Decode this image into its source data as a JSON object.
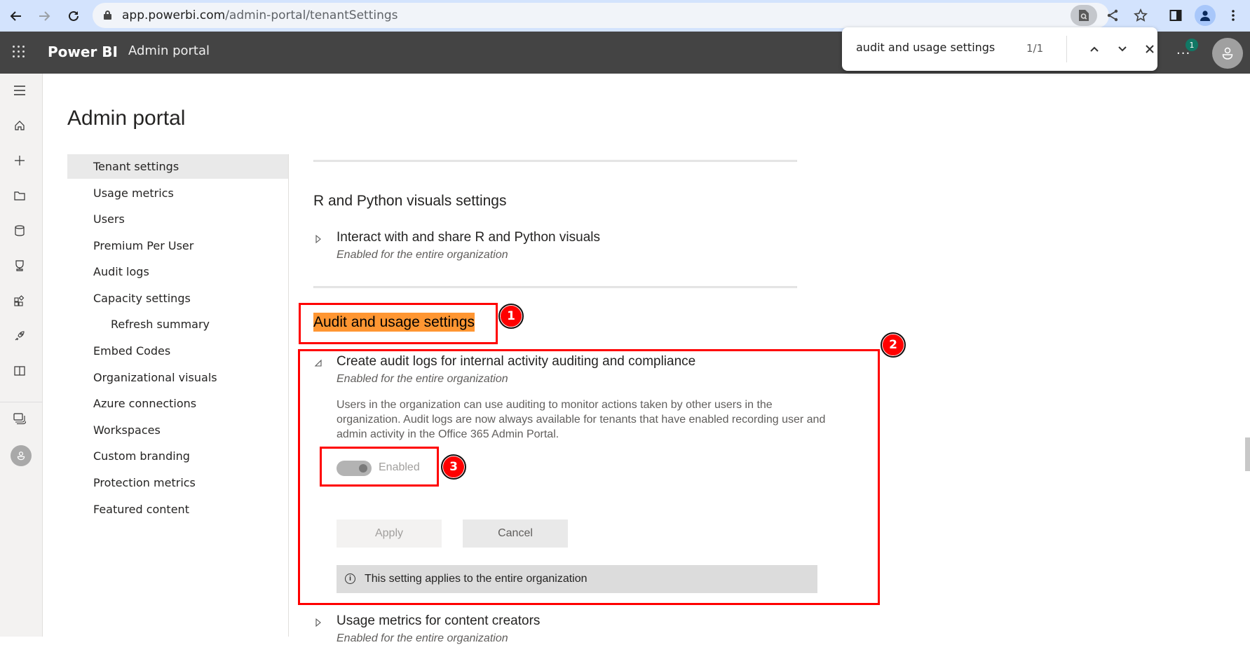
{
  "browser": {
    "url_host": "app.powerbi.com",
    "url_path": "/admin-portal/tenantSettings",
    "icons": [
      "back-icon",
      "forward-icon",
      "reload-icon",
      "lock-icon",
      "search-page-icon",
      "share-icon",
      "bookmark-star-icon",
      "side-panel-icon",
      "profile-icon",
      "menu-kebab-icon"
    ]
  },
  "find_bar": {
    "query": "audit and usage settings",
    "count": "1/1"
  },
  "appbar": {
    "brand": "Power BI",
    "section": "Admin portal",
    "more": "...",
    "notification_count": "1"
  },
  "rail": {
    "icons": [
      "hamburger-menu-icon",
      "home-icon",
      "create-plus-icon",
      "browse-folder-icon",
      "data-hub-cylinder-icon",
      "metrics-trophy-icon",
      "apps-icon",
      "deployment-pipelines-rocket-icon",
      "learn-book-icon",
      "workspaces-icon",
      "account-avatar-icon"
    ]
  },
  "page": {
    "title": "Admin portal"
  },
  "admin_nav": [
    {
      "label": "Tenant settings",
      "active": true,
      "sub": false
    },
    {
      "label": "Usage metrics",
      "active": false,
      "sub": false
    },
    {
      "label": "Users",
      "active": false,
      "sub": false
    },
    {
      "label": "Premium Per User",
      "active": false,
      "sub": false
    },
    {
      "label": "Audit logs",
      "active": false,
      "sub": false
    },
    {
      "label": "Capacity settings",
      "active": false,
      "sub": false
    },
    {
      "label": "Refresh summary",
      "active": false,
      "sub": true
    },
    {
      "label": "Embed Codes",
      "active": false,
      "sub": false
    },
    {
      "label": "Organizational visuals",
      "active": false,
      "sub": false
    },
    {
      "label": "Azure connections",
      "active": false,
      "sub": false
    },
    {
      "label": "Workspaces",
      "active": false,
      "sub": false
    },
    {
      "label": "Custom branding",
      "active": false,
      "sub": false
    },
    {
      "label": "Protection metrics",
      "active": false,
      "sub": false
    },
    {
      "label": "Featured content",
      "active": false,
      "sub": false
    }
  ],
  "content": {
    "r_python": {
      "section_title": "R and Python visuals settings",
      "setting_title": "Interact with and share R and Python visuals",
      "setting_status": "Enabled for the entire organization"
    },
    "audit": {
      "section_title": "Audit and usage settings",
      "setting_title": "Create audit logs for internal activity auditing and compliance",
      "setting_status": "Enabled for the entire organization",
      "description": "Users in the organization can use auditing to monitor actions taken by other users in the organization. Audit logs are now always available for tenants that have enabled recording user and admin activity in the Office 365 Admin Portal.",
      "toggle_label": "Enabled",
      "toggle_on": true,
      "apply_label": "Apply",
      "cancel_label": "Cancel",
      "info_text": "This setting applies to the entire organization"
    },
    "usage_metrics": {
      "setting_title": "Usage metrics for content creators",
      "setting_status": "Enabled for the entire organization"
    }
  },
  "annotations": [
    {
      "label": "1",
      "target": "Audit and usage settings heading"
    },
    {
      "label": "2",
      "target": "Create audit logs setting panel"
    },
    {
      "label": "3",
      "target": "Enabled toggle"
    }
  ],
  "colors": {
    "appbar_bg": "#444444",
    "find_highlight": "#ff9632",
    "annotation_red": "#ff0000",
    "notification_badge": "#117865"
  }
}
